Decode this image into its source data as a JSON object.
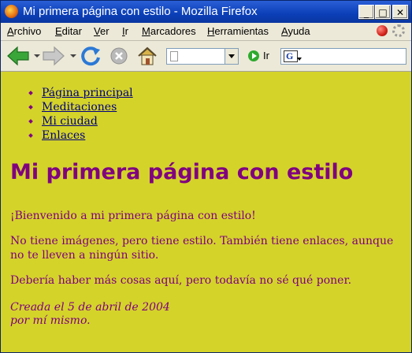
{
  "window": {
    "title": "Mi primera página con estilo - Mozilla Firefox",
    "controls": {
      "minimize": "_",
      "maximize": "□",
      "close": "✕"
    }
  },
  "menubar": {
    "items": [
      "Archivo",
      "Editar",
      "Ver",
      "Ir",
      "Marcadores",
      "Herramientas",
      "Ayuda"
    ]
  },
  "toolbar": {
    "go_label": "Ir",
    "url_value": "",
    "search_engine_glyph": "G",
    "icons": [
      "back-arrow-icon",
      "forward-arrow-icon",
      "reload-icon",
      "stop-icon",
      "home-icon",
      "go-icon"
    ]
  },
  "page": {
    "background": "#d4d32a",
    "text_color": "#800080",
    "link_color": "#000080",
    "nav": [
      "Página principal",
      "Meditaciones",
      "Mi ciudad",
      "Enlaces"
    ],
    "heading": "Mi primera página con estilo",
    "paragraphs": [
      "¡Bienvenido a mi primera página con estilo!",
      "No tiene imágenes, pero tiene estilo. También tiene enlaces, aunque no te lleven a ningún sitio.",
      "Debería haber más cosas aquí, pero todavía no sé qué poner."
    ],
    "address_line1": "Creada el 5 de abril de 2004",
    "address_line2": "por mí mismo."
  }
}
